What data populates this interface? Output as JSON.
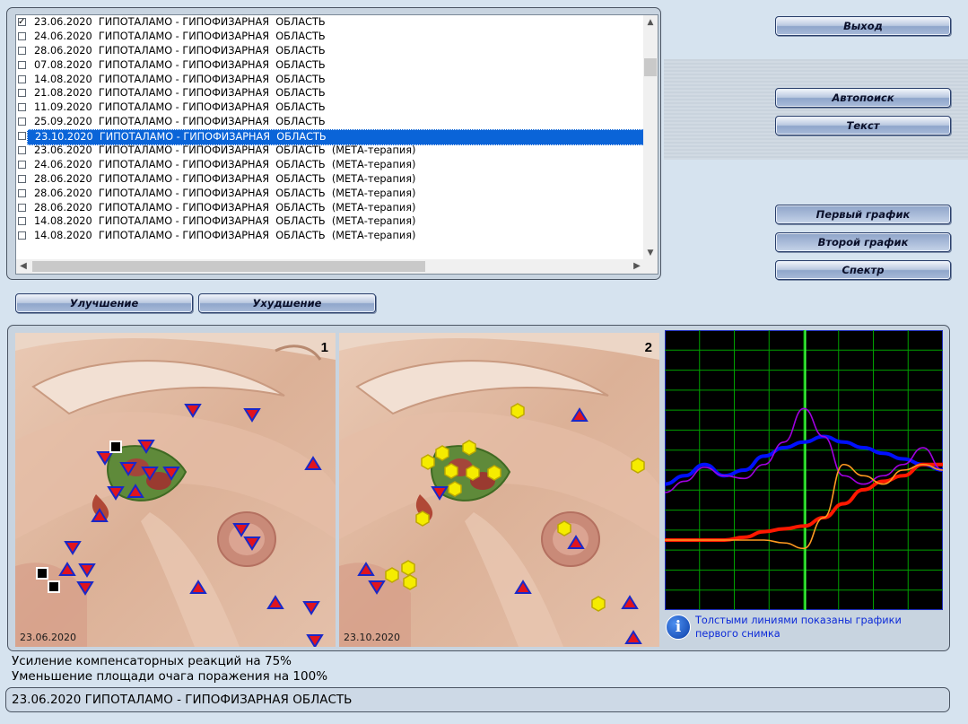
{
  "list": {
    "items": [
      {
        "text": "23.06.2020  ГИПОТАЛАМО - ГИПОФИЗАРНАЯ  ОБЛАСТЬ",
        "checked": true,
        "selected": false
      },
      {
        "text": "24.06.2020  ГИПОТАЛАМО - ГИПОФИЗАРНАЯ  ОБЛАСТЬ",
        "checked": false,
        "selected": false
      },
      {
        "text": "28.06.2020  ГИПОТАЛАМО - ГИПОФИЗАРНАЯ  ОБЛАСТЬ",
        "checked": false,
        "selected": false
      },
      {
        "text": "07.08.2020  ГИПОТАЛАМО - ГИПОФИЗАРНАЯ  ОБЛАСТЬ",
        "checked": false,
        "selected": false
      },
      {
        "text": "14.08.2020  ГИПОТАЛАМО - ГИПОФИЗАРНАЯ  ОБЛАСТЬ",
        "checked": false,
        "selected": false
      },
      {
        "text": "21.08.2020  ГИПОТАЛАМО - ГИПОФИЗАРНАЯ  ОБЛАСТЬ",
        "checked": false,
        "selected": false
      },
      {
        "text": "11.09.2020  ГИПОТАЛАМО - ГИПОФИЗАРНАЯ  ОБЛАСТЬ",
        "checked": false,
        "selected": false
      },
      {
        "text": "25.09.2020  ГИПОТАЛАМО - ГИПОФИЗАРНАЯ  ОБЛАСТЬ",
        "checked": false,
        "selected": false
      },
      {
        "text": "23.10.2020  ГИПОТАЛАМО - ГИПОФИЗАРНАЯ  ОБЛАСТЬ",
        "checked": false,
        "selected": true
      },
      {
        "text": "23.06.2020  ГИПОТАЛАМО - ГИПОФИЗАРНАЯ  ОБЛАСТЬ  (МЕТА-терапия)",
        "checked": false,
        "selected": false
      },
      {
        "text": "24.06.2020  ГИПОТАЛАМО - ГИПОФИЗАРНАЯ  ОБЛАСТЬ  (МЕТА-терапия)",
        "checked": false,
        "selected": false
      },
      {
        "text": "28.06.2020  ГИПОТАЛАМО - ГИПОФИЗАРНАЯ  ОБЛАСТЬ  (МЕТА-терапия)",
        "checked": false,
        "selected": false
      },
      {
        "text": "28.06.2020  ГИПОТАЛАМО - ГИПОФИЗАРНАЯ  ОБЛАСТЬ  (МЕТА-терапия)",
        "checked": false,
        "selected": false
      },
      {
        "text": "28.06.2020  ГИПОТАЛАМО - ГИПОФИЗАРНАЯ  ОБЛАСТЬ  (МЕТА-терапия)",
        "checked": false,
        "selected": false
      },
      {
        "text": "14.08.2020  ГИПОТАЛАМО - ГИПОФИЗАРНАЯ  ОБЛАСТЬ  (МЕТА-терапия)",
        "checked": false,
        "selected": false
      },
      {
        "text": "14.08.2020  ГИПОТАЛАМО - ГИПОФИЗАРНАЯ  ОБЛАСТЬ  (МЕТА-терапия)",
        "checked": false,
        "selected": false
      }
    ]
  },
  "buttons": {
    "exit": "Выход",
    "autosearch": "Автопоиск",
    "text": "Текст",
    "first_graph": "Первый график",
    "second_graph": "Второй график",
    "spectrum": "Спектр",
    "improvement": "Улучшение",
    "deterioration": "Ухудшение"
  },
  "scans": [
    {
      "number": "1",
      "date": "23.06.2020"
    },
    {
      "number": "2",
      "date": "23.10.2020"
    }
  ],
  "note": {
    "icon": "info-icon",
    "text_line1": "Толстыми линиями показаны графики",
    "text_line2": "первого снимка"
  },
  "results": {
    "line1": "Усиление компенсаторных реакций на 75%",
    "line2": "Уменьшение площади очага поражения на 100%"
  },
  "status": "23.06.2020 ГИПОТАЛАМО - ГИПОФИЗАРНАЯ  ОБЛАСТЬ",
  "colors": {
    "graph_bg": "#000000",
    "grid": "#00a000",
    "marker_line": "#40ff40",
    "series_blue": "#0010ff",
    "series_red": "#ff1800",
    "series_purple": "#a000e0",
    "series_orange": "#ff9a20",
    "selection": "#0a64d8"
  },
  "chart_data": {
    "type": "line",
    "series": [
      {
        "color": "#0010ff",
        "thick": true,
        "values": [
          0.45,
          0.48,
          0.52,
          0.48,
          0.5,
          0.55,
          0.58,
          0.6,
          0.62,
          0.6,
          0.58,
          0.56,
          0.54,
          0.52,
          0.5
        ]
      },
      {
        "color": "#ff1800",
        "thick": true,
        "values": [
          0.25,
          0.25,
          0.25,
          0.25,
          0.26,
          0.28,
          0.29,
          0.3,
          0.33,
          0.38,
          0.43,
          0.46,
          0.48,
          0.52,
          0.52
        ]
      },
      {
        "color": "#a000e0",
        "thick": false,
        "values": [
          0.42,
          0.46,
          0.51,
          0.48,
          0.47,
          0.52,
          0.6,
          0.72,
          0.62,
          0.48,
          0.45,
          0.48,
          0.52,
          0.58,
          0.5
        ]
      },
      {
        "color": "#ff9a20",
        "thick": false,
        "values": [
          0.25,
          0.25,
          0.25,
          0.25,
          0.25,
          0.25,
          0.24,
          0.22,
          0.33,
          0.52,
          0.48,
          0.45,
          0.5,
          0.52,
          0.5
        ]
      }
    ]
  }
}
